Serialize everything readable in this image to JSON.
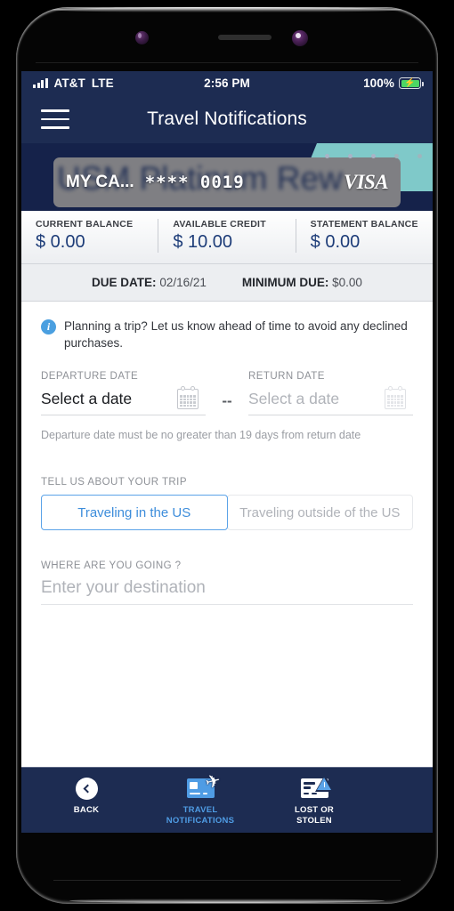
{
  "status_bar": {
    "carrier": "AT&T",
    "network": "LTE",
    "time": "2:56 PM",
    "battery_percent": "100%",
    "battery_bolt": "⚡",
    "signal_icon": "signal-bars-icon",
    "battery_icon": "battery-charging-icon"
  },
  "header": {
    "title": "Travel Notifications",
    "menu_icon": "hamburger-menu-icon"
  },
  "card": {
    "background_text": "USM Platinum Rew",
    "nickname": "MY CA...",
    "number_masked": "**** 0019",
    "brand": "VISA",
    "pager_dot_count": 5,
    "teal_color": "#7fc9c9",
    "navy_color": "#15224a"
  },
  "balances": [
    {
      "label": "CURRENT BALANCE",
      "value": "$ 0.00"
    },
    {
      "label": "AVAILABLE CREDIT",
      "value": "$ 10.00"
    },
    {
      "label": "STATEMENT BALANCE",
      "value": "$ 0.00"
    }
  ],
  "due_row": [
    {
      "label": "DUE DATE:",
      "value": "02/16/21"
    },
    {
      "label": "MINIMUM DUE:",
      "value": "$0.00"
    }
  ],
  "info_banner": {
    "icon": "info-circle-icon",
    "icon_glyph": "i",
    "text": "Planning a trip? Let us know ahead of time to avoid any declined purchases."
  },
  "dates": {
    "departure": {
      "label": "DEPARTURE DATE",
      "value": "Select a date",
      "calendar_icon": "calendar-icon"
    },
    "separator": "--",
    "return": {
      "label": "RETURN DATE",
      "placeholder": "Select a date",
      "calendar_icon": "calendar-icon"
    },
    "helper_text": "Departure date must be no greater than 19 days from return date"
  },
  "trip": {
    "label": "TELL US ABOUT YOUR TRIP",
    "options": [
      {
        "label": "Traveling in the US",
        "selected": true
      },
      {
        "label": "Traveling outside of the US",
        "selected": false
      }
    ],
    "selected_color": "#3d8ddb"
  },
  "destination": {
    "label": "WHERE ARE YOU GOING ?",
    "value": "",
    "placeholder": "Enter your destination"
  },
  "bottom_nav": [
    {
      "label": "BACK",
      "icon": "back-chevron-icon",
      "active": false
    },
    {
      "label": "TRAVEL\nNOTIFICATIONS",
      "label_line1": "TRAVEL",
      "label_line2": "NOTIFICATIONS",
      "icon": "card-airplane-icon",
      "active": true
    },
    {
      "label": "LOST OR\nSTOLEN",
      "label_line1": "LOST OR",
      "label_line2": "STOLEN",
      "icon": "card-warning-icon",
      "active": false
    }
  ]
}
